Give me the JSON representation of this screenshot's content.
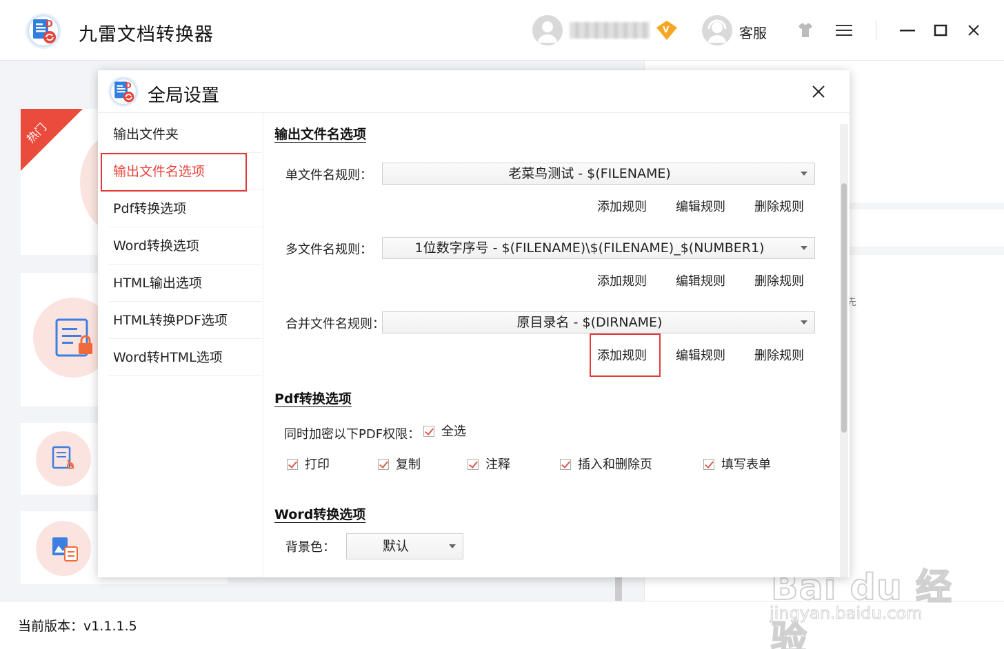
{
  "app": {
    "title": "九雷文档转换器",
    "service_label": "客服",
    "vip_letter": "V"
  },
  "hot_badge": "热门",
  "version_text": "当前版本：v1.1.1.5",
  "background": {
    "side_hint": "先"
  },
  "dialog": {
    "title": "全局设置",
    "nav": [
      {
        "label": "输出文件夹"
      },
      {
        "label": "输出文件名选项"
      },
      {
        "label": "Pdf转换选项"
      },
      {
        "label": "Word转换选项"
      },
      {
        "label": "HTML输出选项"
      },
      {
        "label": "HTML转换PDF选项"
      },
      {
        "label": "Word转HTML选项"
      }
    ],
    "filename_section": {
      "title": "输出文件名选项",
      "rules": [
        {
          "label": "单文件名规则：",
          "value": "老菜鸟测试 - $(FILENAME)"
        },
        {
          "label": "多文件名规则：",
          "value": "1位数字序号 - $(FILENAME)\\$(FILENAME)_$(NUMBER1)"
        },
        {
          "label": "合并文件名规则：",
          "value": "原目录名 - $(DIRNAME)"
        }
      ],
      "buttons": {
        "add": "添加规则",
        "edit": "编辑规则",
        "delete": "删除规则"
      }
    },
    "pdf_section": {
      "title": "Pdf转换选项",
      "perm_label": "同时加密以下PDF权限：",
      "select_all": "全选",
      "perms": [
        {
          "label": "打印"
        },
        {
          "label": "复制"
        },
        {
          "label": "注释"
        },
        {
          "label": "插入和删除页"
        },
        {
          "label": "填写表单"
        }
      ]
    },
    "word_section": {
      "title": "Word转换选项",
      "bg_label": "背景色：",
      "bg_value": "默认"
    }
  },
  "watermark": {
    "main": "Bai du 经验",
    "sub": "jingyan.baidu.com"
  },
  "colors": {
    "accent": "#e8443a",
    "highlight": "#e23a3a",
    "ribbon": "#ea4b3c"
  }
}
